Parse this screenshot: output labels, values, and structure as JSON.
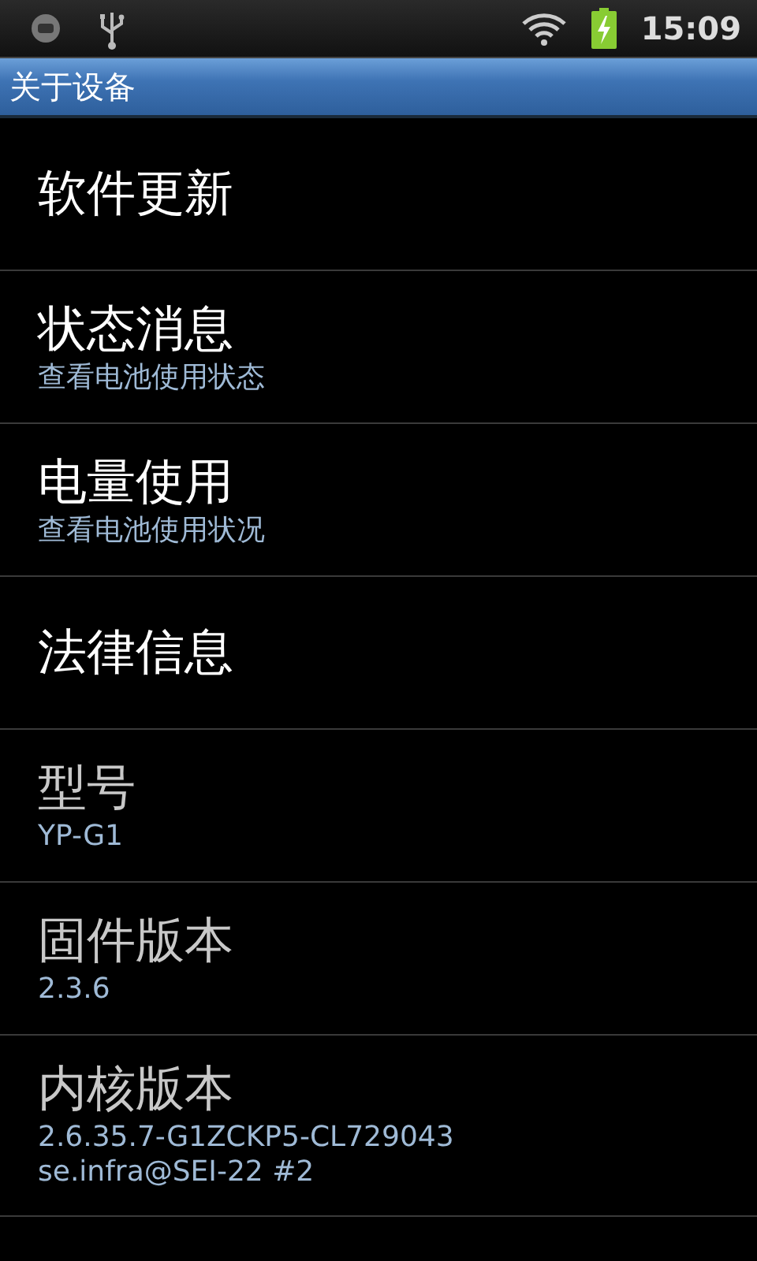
{
  "status_bar": {
    "time": "15:09"
  },
  "title_bar": {
    "title": "关于设备"
  },
  "items": [
    {
      "title": "软件更新",
      "kind": "action"
    },
    {
      "title": "状态消息",
      "summary": "查看电池使用状态",
      "kind": "action"
    },
    {
      "title": "电量使用",
      "summary": "查看电池使用状况",
      "kind": "action"
    },
    {
      "title": "法律信息",
      "kind": "action"
    },
    {
      "title": "型号",
      "summary": "YP-G1",
      "kind": "info"
    },
    {
      "title": "固件版本",
      "summary": "2.3.6",
      "kind": "info"
    },
    {
      "title": "内核版本",
      "summary": "2.6.35.7-G1ZCKP5-CL729043\nse.infra@SEI-22 #2",
      "kind": "info"
    }
  ]
}
